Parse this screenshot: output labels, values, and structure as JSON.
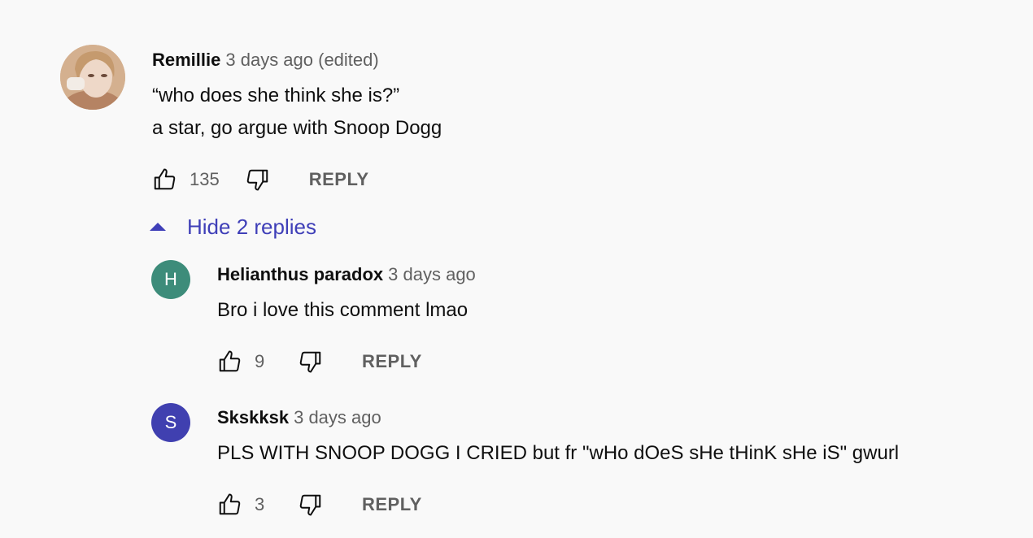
{
  "comments": [
    {
      "author": "Remillie",
      "time": "3 days ago (edited)",
      "lines": [
        "“who does she think she is?”",
        "a star, go argue with Snoop Dogg"
      ],
      "likes": "135",
      "reply_label": "REPLY"
    }
  ],
  "replies_toggle": {
    "label": "Hide 2 replies"
  },
  "replies": [
    {
      "avatar_letter": "H",
      "avatar_color": "#3d8c7a",
      "author": "Helianthus paradox",
      "time": "3 days ago",
      "text": "Bro i love this comment lmao",
      "likes": "9",
      "reply_label": "REPLY"
    },
    {
      "avatar_letter": "S",
      "avatar_color": "#4040b0",
      "author": "Skskksk",
      "time": "3 days ago",
      "text": "PLS WITH SNOOP DOGG I CRIED but fr \"wHo dOeS sHe tHinK sHe iS\" gwurl",
      "likes": "3",
      "reply_label": "REPLY"
    }
  ],
  "icons": {
    "like": "thumbs-up-icon",
    "dislike": "thumbs-down-icon",
    "toggle": "caret-up-icon"
  },
  "colors": {
    "background": "#f9f9f9",
    "link": "#3f3fb8",
    "secondary_text": "#606060"
  }
}
